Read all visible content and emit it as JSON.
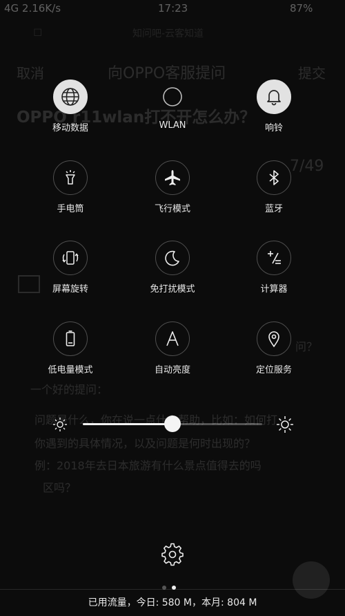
{
  "status_bar": {
    "left": "4G 2.16K/s",
    "time": "17:23",
    "battery": "87%"
  },
  "background_page": {
    "top_text": "知问吧-云客知道",
    "cancel": "取消",
    "title": "向OPPO客服提问",
    "submit": "提交",
    "question": "OPPO r11wlan打不开怎么办？",
    "counter": "7/49",
    "tip_line": "一个好的提问：",
    "bullet_1": "问题是什么，你在说一点什么帮助，比如：如何打",
    "bullet_2": "你遇到的具体情况，以及问题是何时出现的？",
    "bullet_3": "例：2018年去日本旅游有什么景点值得去的吗",
    "bullet_3b": "区吗？",
    "side_hint": "问？"
  },
  "tiles": [
    {
      "label": "移动数据",
      "icon": "globe-icon",
      "active": true
    },
    {
      "label": "WLAN",
      "icon": "wifi-ring-icon",
      "active": false
    },
    {
      "label": "响铃",
      "icon": "bell-icon",
      "active": true
    },
    {
      "label": "手电筒",
      "icon": "flashlight-icon",
      "active": false
    },
    {
      "label": "飞行模式",
      "icon": "airplane-icon",
      "active": false
    },
    {
      "label": "蓝牙",
      "icon": "bluetooth-icon",
      "active": false
    },
    {
      "label": "屏幕旋转",
      "icon": "rotate-screen-icon",
      "active": false
    },
    {
      "label": "免打扰模式",
      "icon": "moon-icon",
      "active": false
    },
    {
      "label": "计算器",
      "icon": "calculator-icon",
      "active": false
    },
    {
      "label": "低电量模式",
      "icon": "battery-icon",
      "active": false
    },
    {
      "label": "自动亮度",
      "icon": "auto-brightness-icon",
      "active": false
    },
    {
      "label": "定位服务",
      "icon": "location-icon",
      "active": false
    }
  ],
  "brightness": {
    "level": 0.5,
    "low_icon": "sun-small-icon",
    "high_icon": "sun-large-icon"
  },
  "settings_icon": "gear-icon",
  "page_indicator": {
    "count": 2,
    "current": 2
  },
  "data_usage": "已用流量，今日: 580 M，本月: 804 M",
  "colors": {
    "active_circle": "#e2e2e2",
    "background": "#0c0c0c"
  }
}
